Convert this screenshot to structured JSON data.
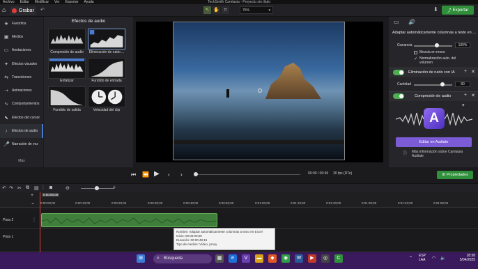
{
  "menubar": {
    "items": [
      "Archivo",
      "Editar",
      "Modificar",
      "Ver",
      "Exportar",
      "Ayuda"
    ]
  },
  "window_title": "TechSmith Camtasia - Proyecto sin título",
  "toolbar": {
    "record_label": "Grabar",
    "zoom_value": "75%",
    "export_label": "Exportar"
  },
  "sidebar": {
    "items": [
      {
        "label": "Favoritos",
        "icon": "star-icon"
      },
      {
        "label": "Medios",
        "icon": "media-icon"
      },
      {
        "label": "Anotaciones",
        "icon": "annotation-icon"
      },
      {
        "label": "Efectos visuales",
        "icon": "visual-effects-icon"
      },
      {
        "label": "Transiciones",
        "icon": "transition-icon"
      },
      {
        "label": "Animaciones",
        "icon": "animation-icon"
      },
      {
        "label": "Comportamientos",
        "icon": "behavior-icon"
      },
      {
        "label": "Efectos del cursor",
        "icon": "cursor-icon"
      },
      {
        "label": "Efectos de audio",
        "icon": "audio-icon"
      },
      {
        "label": "Narración de voz",
        "icon": "microphone-icon"
      }
    ],
    "more_label": "Más",
    "active_index": 8
  },
  "effects_panel": {
    "title": "Efectos de audio",
    "items": [
      {
        "label": "Compresión de audio"
      },
      {
        "label": "Eliminación de ruido ..."
      },
      {
        "label": "Enfatizar"
      },
      {
        "label": "Fundido de entrada"
      },
      {
        "label": "Fundido de salida"
      },
      {
        "label": "Velocidad del clip"
      }
    ]
  },
  "playback": {
    "timecode": "00:00 / 00:49",
    "fps": "30 fps (DTe)",
    "properties_label": "Propiedades"
  },
  "right_panel": {
    "header_title": "Adaptar automáticamente columnas a texto en ...",
    "gain_label": "Ganancia",
    "gain_value": "100%",
    "mix_mono_label": "Mezcla en mono",
    "auto_normalize_label": "Normalización auto. del volumen",
    "noise_title": "Eliminación de ruido con IA",
    "amount_label": "Cantidad",
    "amount_value": "80",
    "compression_title": "Compresión de audio",
    "audiate_button": "Editar en Audiate",
    "audiate_info": "Más información sobre Camtasia Audiate",
    "audiate_logo_letter": "A"
  },
  "timeline": {
    "playhead_time": "0:00:00;00",
    "ticks": [
      "0:00:00;00",
      "0:00:10;00",
      "0:00:20;00",
      "0:00:30;00",
      "0:00:40;00",
      "0:00:50;00",
      "0:01:00;00",
      "0:01:10;00",
      "0:01:20;00",
      "0:01:30;00",
      "0:01:40;00",
      "0:01:50;00"
    ],
    "tracks": [
      {
        "label": "Pista 2"
      },
      {
        "label": "Pista 1"
      }
    ],
    "tooltip": {
      "line1": "Nombre: Adaptar automáticamente columnas a texto en Excel",
      "line2": "Inicio: 00:00:00;00",
      "line3": "Duración: 00:00:49;15",
      "line4": "Tipo de medios: Vídeo, proxy"
    }
  },
  "taskbar": {
    "search_placeholder": "Búsqueda",
    "lang_line1": "ESP",
    "lang_line2": "LAA",
    "time": "18:38",
    "date": "5/04/2025"
  }
}
